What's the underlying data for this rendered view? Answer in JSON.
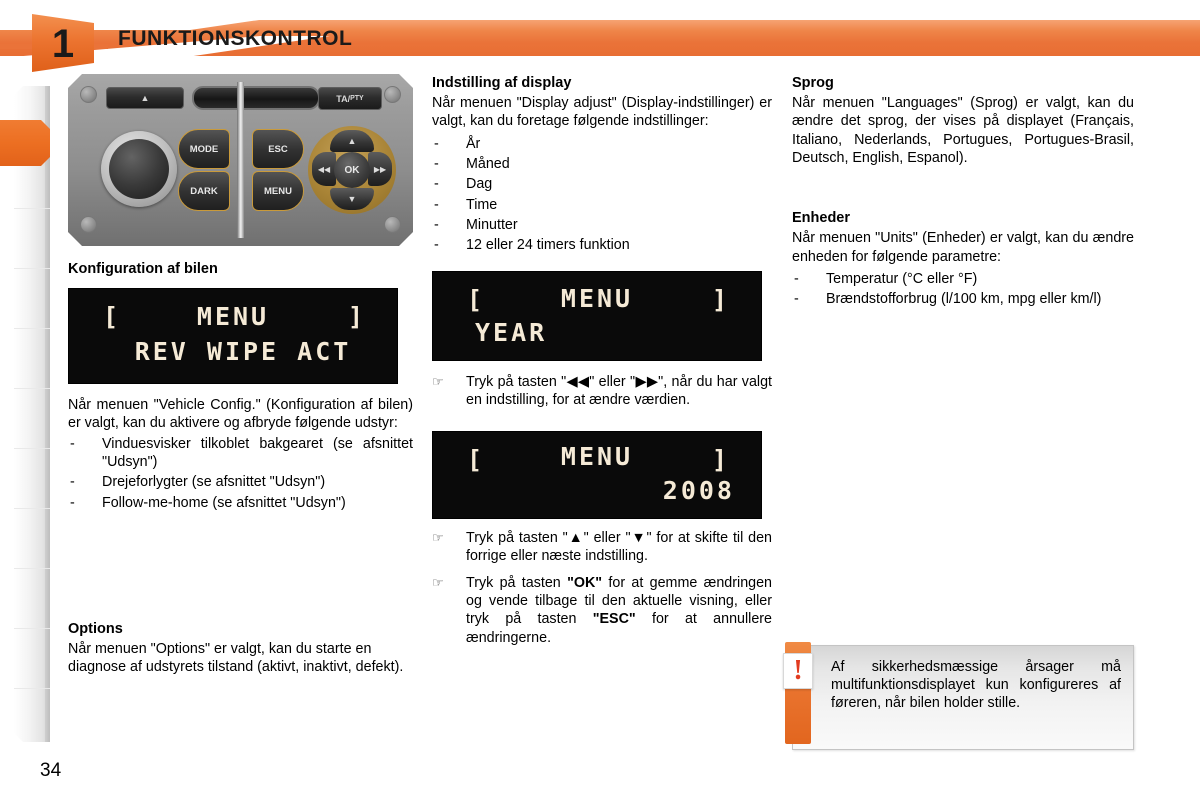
{
  "header": {
    "chapter_number": "1",
    "title": "FUNKTIONSKONTROL",
    "accent_color": "#ea7339"
  },
  "sidebar": {
    "active_index": 0,
    "tab_count": 11
  },
  "page_number": "34",
  "control_panel": {
    "buttons": {
      "eject": "▲",
      "ta_pty_prefix": "TA/",
      "ta_pty_suffix": "PTY",
      "mode": "MODE",
      "dark": "DARK",
      "esc": "ESC",
      "menu": "MENU",
      "ok": "OK",
      "up": "▲",
      "down": "▼",
      "left": "◀◀",
      "right": "▶▶"
    }
  },
  "left_column": {
    "config_heading": "Konfiguration af bilen",
    "lcd1": {
      "bracket_left": "[",
      "bracket_right": "]",
      "line1": "MENU",
      "line2": "REV WIPE ACT"
    },
    "config_intro": "Når menuen \"Vehicle Config.\" (Konfiguration af bilen) er valgt, kan du aktivere og afbryde følgende udstyr:",
    "config_items": [
      "Vinduesvisker tilkoblet bakgearet (se afsnittet \"Udsyn\")",
      "Drejeforlygter (se afsnittet \"Udsyn\")",
      "Follow-me-home (se afsnittet \"Udsyn\")"
    ],
    "options_heading": "Options",
    "options_text": "Når menuen \"Options\" er valgt, kan du starte en diagnose af udstyrets tilstand (aktivt, inaktivt, defekt)."
  },
  "middle_column": {
    "display_heading": "Indstilling af display",
    "display_intro": "Når menuen \"Display adjust\" (Display-indstillinger) er valgt, kan du foretage følgende indstillinger:",
    "display_items": [
      "År",
      "Måned",
      "Dag",
      "Time",
      "Minutter",
      "12 eller 24 timers funktion"
    ],
    "lcd2": {
      "bracket_left": "[",
      "bracket_right": "]",
      "line1": "MENU",
      "line2": "YEAR"
    },
    "instruction1": "Tryk på tasten \"◀◀\" eller \"▶▶\", når du har valgt en indstilling, for at ændre værdien.",
    "lcd3": {
      "bracket_left": "[",
      "bracket_right": "]",
      "line1": "MENU",
      "line2": "2008"
    },
    "instruction2": "Tryk på tasten \"▲\" eller \"▼\" for at skifte til den forrige eller næste indstilling.",
    "instruction3_part1": "Tryk på tasten ",
    "instruction3_ok": "\"OK\"",
    "instruction3_part2": " for at gemme ændringen og vende tilbage til den aktuelle visning, eller tryk på tasten ",
    "instruction3_esc": "\"ESC\"",
    "instruction3_part3": " for at annullere ændringerne.",
    "hand_bullet": "☞"
  },
  "right_column": {
    "language_heading": "Sprog",
    "language_text": "Når menuen \"Languages\" (Sprog) er valgt, kan du ændre det sprog, der vises på displayet (Français, Italiano, Nederlands, Portugues, Portugues-Brasil, Deutsch, English, Espanol).",
    "units_heading": "Enheder",
    "units_intro": "Når menuen \"Units\" (Enheder) er valgt, kan du ændre enheden for følgende parametre:",
    "units_items": [
      "Temperatur (°C eller °F)",
      "Brændstofforbrug (l/100 km, mpg eller km/l)"
    ]
  },
  "warning": {
    "icon": "!",
    "text": "Af sikkerhedsmæssige årsager må multifunktionsdisplayet kun konfigureres af føreren, når bilen holder stille."
  }
}
